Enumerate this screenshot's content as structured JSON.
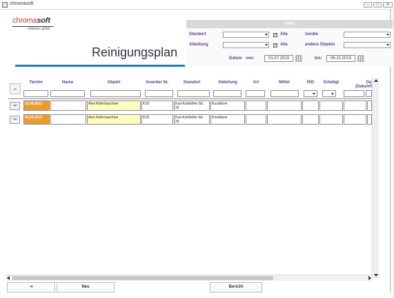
{
  "window": {
    "title": "chromasoft"
  },
  "logo": {
    "brand_a": "chroma",
    "brand_b": "soft",
    "tagline": "software gmbh"
  },
  "page": {
    "title": "Reinigungsplan"
  },
  "filter": {
    "header": "Filter",
    "standort_label": "Standort",
    "abteilung_label": "Abteilung",
    "alle1_label": "Alle",
    "alle2_label": "Alle",
    "alle1_checked": true,
    "alle2_checked": true,
    "geraete_label": "Geräte",
    "andere_label": "andere Objekte",
    "datum_label": "Datum",
    "von_label": "von:",
    "von_value": "01.07.2013",
    "bis_label": "bis:",
    "bis_value": "06.10.2013"
  },
  "columns": [
    "Termin",
    "Name",
    "Objekt",
    "Inventar Nr.",
    "Standort",
    "Abteilung",
    "Art",
    "Mittel",
    "R/D",
    "Erledigt",
    "Gep-\n(Datum/Ur"
  ],
  "rows": [
    {
      "termin": "13.08.2013",
      "name": "",
      "objekt": "Alex Rührmaschine",
      "inventar": "K18",
      "standort": "Karl-Kahlhöfer-Str. 25",
      "abteilung": "Konditorei"
    },
    {
      "termin": "01.09.2013",
      "name": "",
      "objekt": "Alex Rührmaschine",
      "inventar": "K18",
      "standort": "Karl-Kahlhöfer-Str. 25",
      "abteilung": "Konditorei"
    }
  ],
  "row_button_symbol": "⇒",
  "footer": {
    "exit_symbol": "⇥",
    "neu_label": "Neu",
    "bericht_label": "Bericht"
  },
  "colors": {
    "accent_blue": "#1e7bc8",
    "termin_orange": "#f19a2b",
    "objekt_yellow": "#ffffc0",
    "label_purple": "#5b3d8e"
  }
}
